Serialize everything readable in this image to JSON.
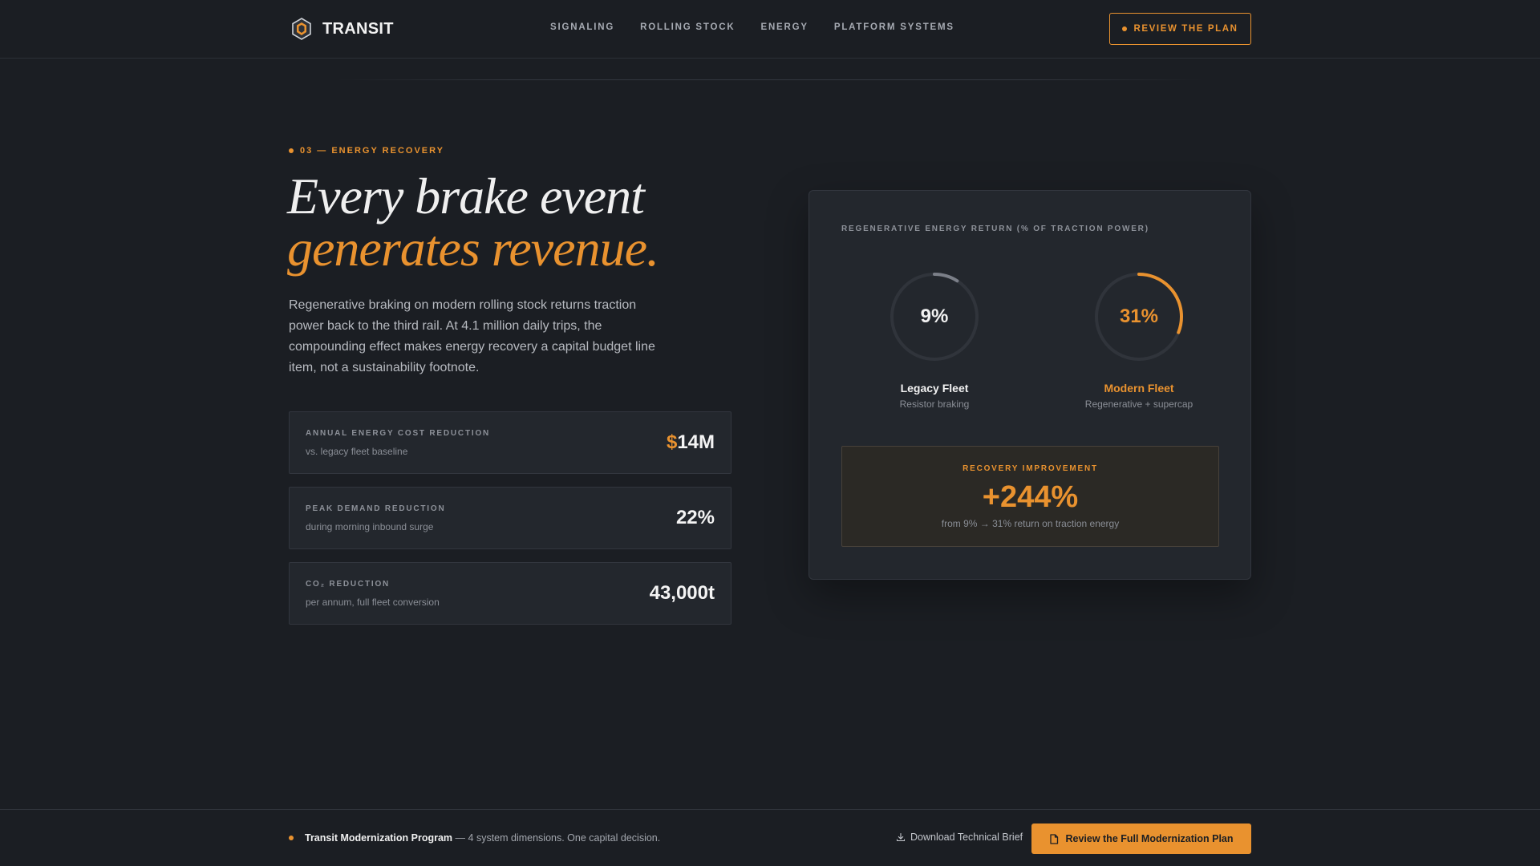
{
  "brand": {
    "name": "TRANSIT",
    "logo_icon": "hexagon-shield-icon"
  },
  "nav": {
    "items": [
      "SIGNALING",
      "ROLLING STOCK",
      "ENERGY",
      "PLATFORM SYSTEMS"
    ]
  },
  "header_cta": {
    "label": "REVIEW THE PLAN"
  },
  "hero": {
    "eyebrow": "03 — ENERGY RECOVERY",
    "headline_line1": "Every brake event",
    "headline_line2": "generates revenue.",
    "lede": "Regenerative braking on modern rolling stock returns traction power back to the third rail. At 4.1 million daily trips, the compounding effect makes energy recovery a capital budget line item, not a sustainability footnote."
  },
  "metrics": [
    {
      "label": "ANNUAL ENERGY COST REDUCTION",
      "sub": "vs. legacy fleet baseline",
      "value_prefix": "$",
      "value": "14M"
    },
    {
      "label": "PEAK DEMAND REDUCTION",
      "sub": "during morning inbound surge",
      "value_prefix": "",
      "value": "22%"
    },
    {
      "label": "CO₂ REDUCTION",
      "sub": "per annum, full fleet conversion",
      "value_prefix": "",
      "value": "43,000t"
    }
  ],
  "card": {
    "title": "REGENERATIVE ENERGY RETURN (% OF TRACTION POWER)",
    "gauges": [
      {
        "value": 9,
        "display": "9%",
        "name": "Legacy Fleet",
        "sub": "Resistor braking",
        "color": "#7b7f88",
        "text_color": "#f2f2f2"
      },
      {
        "value": 31,
        "display": "31%",
        "name": "Modern Fleet",
        "sub": "Regenerative + supercap",
        "color": "#e9922f",
        "text_color": "#e9922f"
      }
    ],
    "improvement": {
      "label": "RECOVERY IMPROVEMENT",
      "value": "+244%",
      "sub": "from 9% → 31% return on traction energy"
    }
  },
  "footer": {
    "program_name": "Transit Modernization Program",
    "program_tail": "— 4 system dimensions. One capital decision.",
    "download_label": "Download Technical Brief",
    "download_icon": "download-icon",
    "cta_label": "Review the Full Modernization Plan",
    "cta_icon": "document-icon"
  },
  "colors": {
    "accent": "#e9922f",
    "background": "#1b1e23",
    "surface": "#23272d"
  }
}
